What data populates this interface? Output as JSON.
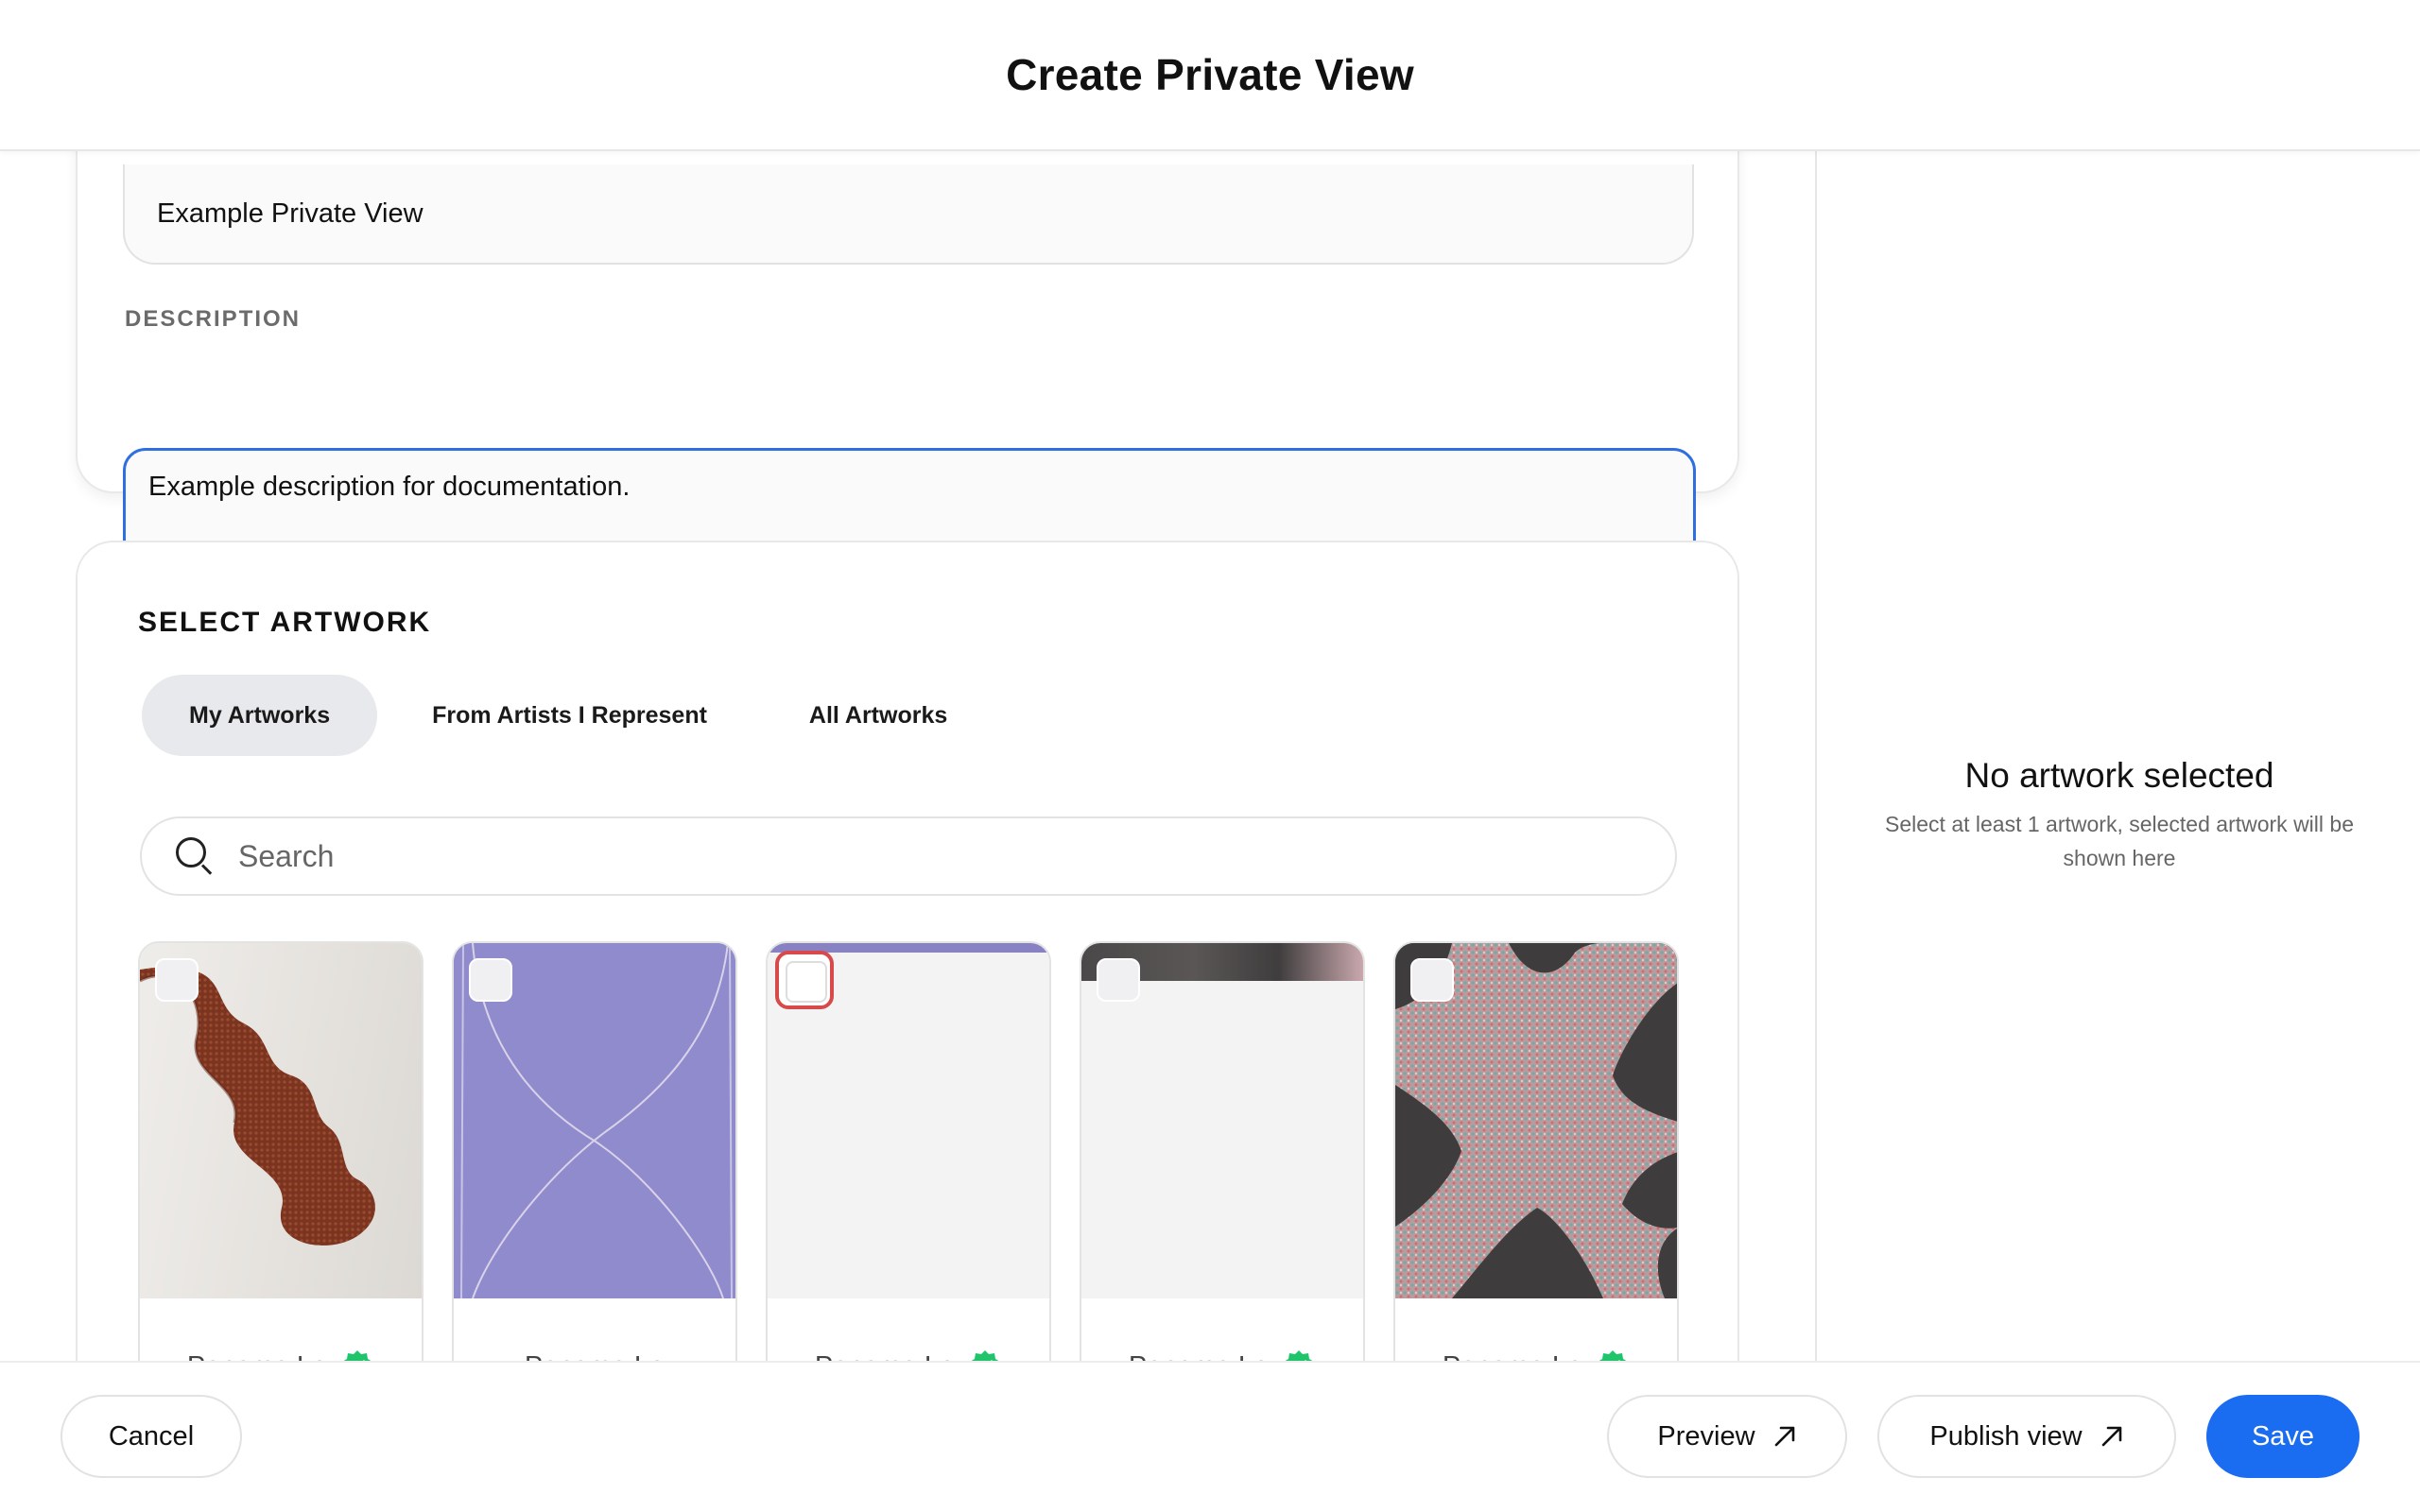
{
  "header": {
    "title": "Create Private View"
  },
  "form": {
    "name_value": "Example Private View",
    "description_label": "DESCRIPTION",
    "description_value": "Example description for documentation."
  },
  "artwork": {
    "section_title": "SELECT ARTWORK",
    "tabs": [
      {
        "label": "My Artworks",
        "active": true
      },
      {
        "label": "From Artists I Represent",
        "active": false
      },
      {
        "label": "All Artworks",
        "active": false
      }
    ],
    "search_placeholder": "Search",
    "items": [
      {
        "artist": "Panama Le",
        "verified": true,
        "image": "brown-coiled-sculpture"
      },
      {
        "artist": "Panama Le",
        "verified": false,
        "image": "purple-textile"
      },
      {
        "artist": "Panama Le",
        "verified": true,
        "image": "blank"
      },
      {
        "artist": "Panama Le",
        "verified": true,
        "image": "blank-with-strip"
      },
      {
        "artist": "Panama Le",
        "verified": true,
        "image": "patterned-cross"
      }
    ],
    "verified_color": "#1fc46b"
  },
  "side": {
    "empty_title": "No artwork selected",
    "empty_subtitle": "Select at least 1 artwork, selected artwork will be shown here"
  },
  "footer": {
    "cancel_label": "Cancel",
    "preview_label": "Preview",
    "publish_label": "Publish view",
    "save_label": "Save"
  },
  "colors": {
    "accent": "#1a6cf0",
    "focus_ring": "#2f6fe0"
  }
}
